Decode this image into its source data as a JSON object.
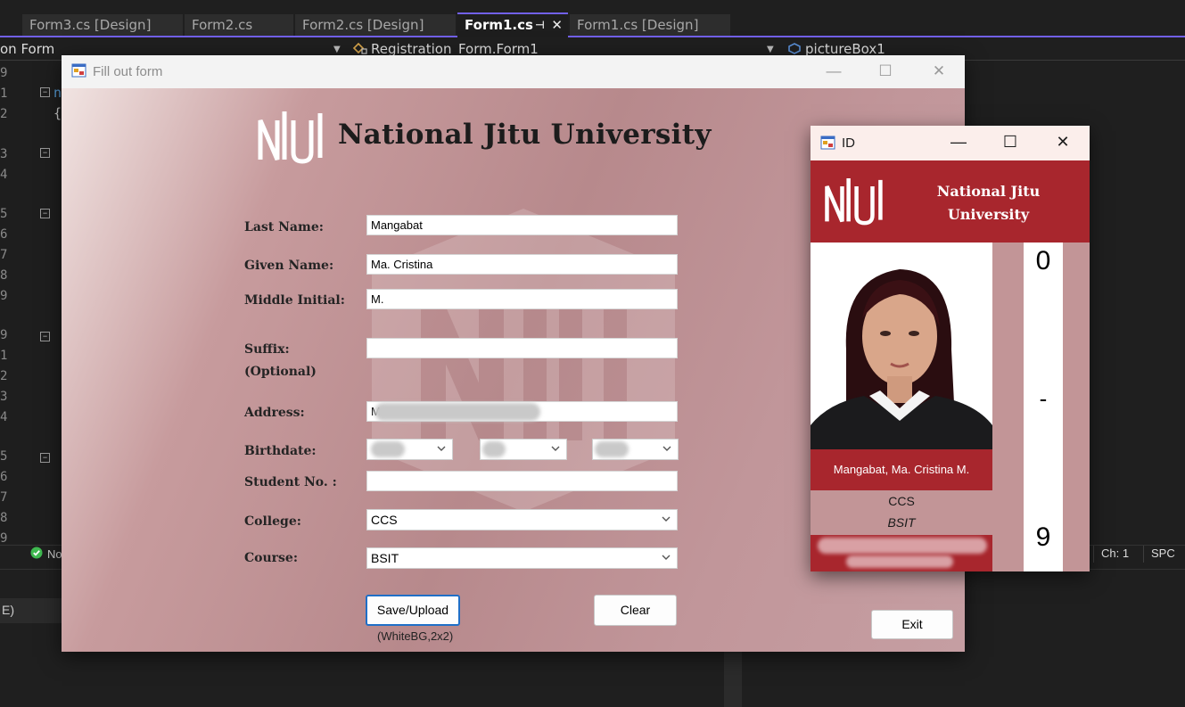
{
  "ide": {
    "tabs": [
      {
        "label": "Form3.cs [Design]"
      },
      {
        "label": "Form2.cs"
      },
      {
        "label": "Form2.cs [Design]"
      },
      {
        "label": "Form1.cs",
        "active": true
      },
      {
        "label": "Form1.cs [Design]"
      }
    ],
    "tab_close_glyph": "✕",
    "tab_pin_glyph": "⊣",
    "nav": {
      "project": "on Form",
      "class": "Registration_Form.Form1",
      "member": "pictureBox1"
    },
    "line_numbers": [
      "9",
      "1",
      "2",
      "3",
      "4",
      "5",
      "6",
      "7",
      "8",
      "9",
      "9",
      "1",
      "2",
      "3",
      "4",
      "5",
      "6",
      "7",
      "8",
      "9"
    ],
    "code_fragment_1": "n",
    "code_fragment_2": "{",
    "status": {
      "issues": "No",
      "ch": "Ch: 1",
      "spc": "SPC"
    },
    "panel_row": "E)"
  },
  "form": {
    "title": "Fill out form",
    "university": "National Jitu University",
    "labels": {
      "last_name": "Last Name:",
      "given_name": "Given Name:",
      "middle_initial": "Middle Initial:",
      "suffix": "Suffix:",
      "optional": "(Optional)",
      "address": "Address:",
      "birthdate": "Birthdate:",
      "student_no": "Student No. :",
      "college": "College:",
      "course": "Course:"
    },
    "values": {
      "last_name": "Mangabat",
      "given_name": "Ma. Cristina",
      "middle_initial": "M.",
      "suffix": "",
      "address": "M",
      "student_no": "",
      "college": "CCS",
      "course": "BSIT"
    },
    "buttons": {
      "save": "Save/Upload",
      "clear": "Clear"
    },
    "note": "(WhiteBG,2x2)"
  },
  "id_card": {
    "title": "ID",
    "university_line1": "National Jitu",
    "university_line2": "University",
    "name": "Mangabat, Ma. Cristina M.",
    "college": "CCS",
    "course": "BSIT",
    "number_top": "0",
    "number_mid": "-",
    "number_bottom": "9",
    "exit": "Exit"
  },
  "window_controls": {
    "minimize": "—",
    "maximize": "☐",
    "close": "✕"
  },
  "colors": {
    "id_red": "#a8262d",
    "form_pink": "#b7898c",
    "accent": "#7160e8"
  }
}
